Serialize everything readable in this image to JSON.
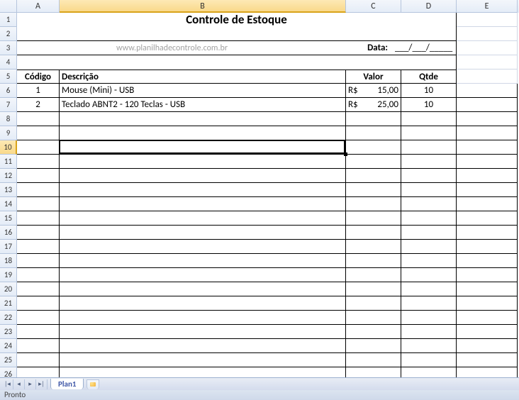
{
  "columns": [
    "A",
    "B",
    "C",
    "D",
    "E"
  ],
  "title": "Controle de Estoque",
  "website": "www.planilhadecontrole.com.br",
  "date_label": "Data:",
  "date_placeholder": "___/___/_____",
  "headers": {
    "codigo": "Código",
    "descricao": "Descrição",
    "valor": "Valor",
    "qtde": "Qtde"
  },
  "currency": "R$",
  "items": [
    {
      "codigo": "1",
      "descricao": "Mouse (Mini) - USB",
      "valor": "15,00",
      "qtde": "10"
    },
    {
      "codigo": "2",
      "descricao": "Teclado ABNT2 - 120 Teclas - USB",
      "valor": "25,00",
      "qtde": "10"
    }
  ],
  "active_cell": {
    "row": 10,
    "col": "B"
  },
  "tab_name": "Plan1",
  "status_text": "Pronto"
}
